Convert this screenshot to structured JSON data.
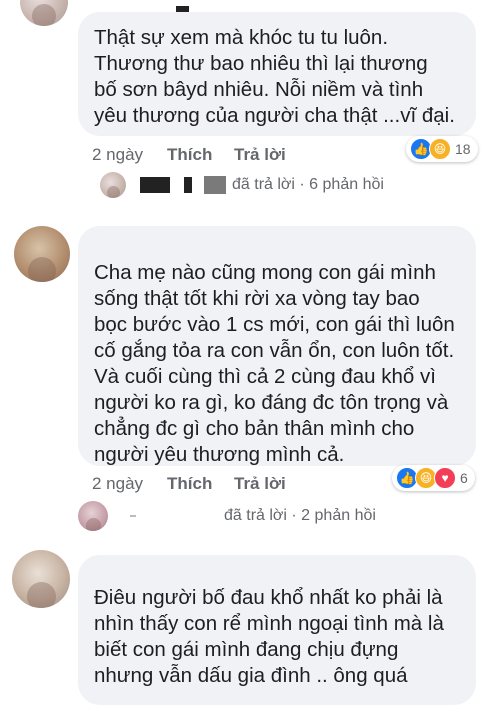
{
  "comments": [
    {
      "text": "Thật sự xem mà khóc tu tu luôn.\nThương thư bao nhiêu thì lại thương\nbố sơn bâyd nhiêu. Nỗi niềm và tình\nyêu thương của người cha thật ...vĩ đại.",
      "time": "2 ngày",
      "like": "Thích",
      "reply": "Trả lời",
      "reaction_count": "18",
      "replies_summary": "đã trả lời · 6 phản hồi"
    },
    {
      "text": "Cha mẹ nào cũng mong con gái mình\nsống thật tốt khi rời xa vòng tay bao\nbọc bước vào 1 cs mới, con gái thì luôn\ncố gắng tỏa ra con vẫn ổn, con luôn tốt.\nVà cuối cùng thì cả 2 cùng đau khổ vì\nngười ko ra gì, ko đáng đc tôn trọng và\nchẳng đc gì cho bản thân mình cho\nngười yêu thương mình cả.",
      "time": "2 ngày",
      "like": "Thích",
      "reply": "Trả lời",
      "reaction_count": "6",
      "replies_summary": "đã trả lời · 2 phản hồi"
    },
    {
      "text": "Điêu người bố đau khổ nhất ko phải là\nnhìn thấy con rể mình ngoại tình mà là\nbiết con gái mình đang chịu đựng\nnhưng vẫn dấu gia đình .. ông quá"
    }
  ],
  "colors": {
    "bubble": "#f0f2f5",
    "meta_text": "#65676b",
    "like_blue": "#1877f2",
    "haha_yellow": "#f7b125",
    "love_red": "#f33e58"
  }
}
